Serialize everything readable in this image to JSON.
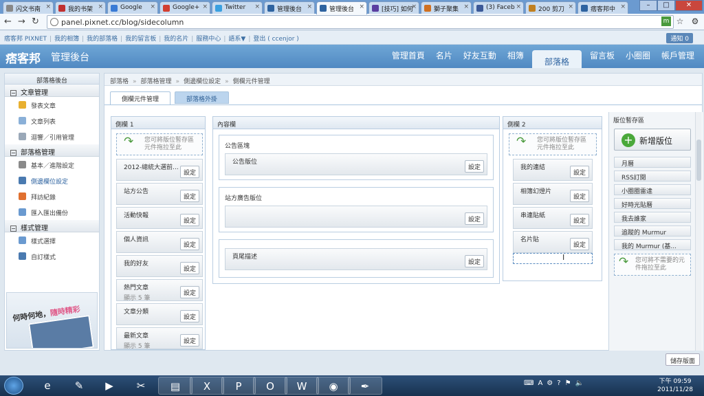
{
  "browser": {
    "tabs": [
      {
        "label": "闪文书南",
        "color": "#888888"
      },
      {
        "label": "我的书架",
        "color": "#c03030"
      },
      {
        "label": "Google",
        "color": "#3a7bd5"
      },
      {
        "label": "Google+",
        "color": "#d23f31"
      },
      {
        "label": "Twitter",
        "color": "#3aa0e0"
      },
      {
        "label": "管理後台",
        "color": "#2e63a0"
      },
      {
        "label": "管理後台",
        "color": "#2e63a0"
      },
      {
        "label": "[技巧] 如何",
        "color": "#5a3ea0"
      },
      {
        "label": "獅子聚集",
        "color": "#d07020"
      },
      {
        "label": "(3) Faceb",
        "color": "#3b5998"
      },
      {
        "label": "200 剪刀",
        "color": "#c08020"
      },
      {
        "label": "痞客邦中",
        "color": "#2e63a0"
      }
    ],
    "url": "panel.pixnet.cc/blog/sidecolumn"
  },
  "toplinks": {
    "items": [
      "痞客邦 PIXNET",
      "我的相簿",
      "我的部落格",
      "我的留言板",
      "我的名片",
      "服務中心",
      "語系▼",
      "登出 ( ccenjor )"
    ],
    "notification": "通知 0"
  },
  "header": {
    "logo": "痞客邦",
    "subtitle": "管理後台",
    "nav": [
      "管理首頁",
      "名片",
      "好友互動",
      "相簿",
      "部落格",
      "留言板",
      "小圈圈",
      "帳戶管理"
    ]
  },
  "sidebar": {
    "title": "部落格後台",
    "sec1": "文章管理",
    "items1": [
      {
        "label": "發表文章",
        "color": "#e8b030"
      },
      {
        "label": "文章列表",
        "color": "#8ab0d8"
      },
      {
        "label": "迴響／引用管理",
        "color": "#9aa8b8"
      }
    ],
    "sec2": "部落格管理",
    "items2": [
      {
        "label": "基本／進階設定",
        "color": "#8a8a8a"
      },
      {
        "label": "側邊欄位設定",
        "color": "#4a7ab0"
      },
      {
        "label": "拜訪紀錄",
        "color": "#e07030"
      },
      {
        "label": "匯入匯出備份",
        "color": "#6a9ad0"
      }
    ],
    "sec3": "樣式管理",
    "items3": [
      {
        "label": "樣式選擇",
        "color": "#6a9ad0"
      },
      {
        "label": "自訂樣式",
        "color": "#4a7ab0"
      }
    ],
    "ad_text1": "何時何地，",
    "ad_text2": "隨時精彩"
  },
  "breadcrumb": [
    "部落格",
    "部落格管理",
    "側邊欄位設定",
    "側欄元件管理"
  ],
  "subtabs": [
    "側欄元件管理",
    "部落格外掛"
  ],
  "colA": {
    "title": "側欄 1",
    "drop": "您可將版位暫存區\n元件拖拉至此",
    "widgets": [
      {
        "label": "2012-總統大選前...",
        "sub": ""
      },
      {
        "label": "站方公告",
        "sub": ""
      },
      {
        "label": "活動快報",
        "sub": ""
      },
      {
        "label": "個人資訊",
        "sub": ""
      },
      {
        "label": "我的好友",
        "sub": ""
      },
      {
        "label": "熱門文章",
        "sub": "顯示 5 筆"
      },
      {
        "label": "文章分類",
        "sub": ""
      },
      {
        "label": "最新文章",
        "sub": "顯示 5 筆"
      }
    ]
  },
  "colB": {
    "title": "內容欄",
    "box1_title": "公告區塊",
    "box1_widget": "公告版位",
    "box2_title": "站方廣告版位",
    "box3_widget": "頁尾描述"
  },
  "colC": {
    "title": "側欄 2",
    "drop": "您可將版位暫存區\n元件拖拉至此",
    "widgets": [
      "我的連結",
      "相簿幻燈片",
      "串連貼紙",
      "名片貼"
    ]
  },
  "temp": {
    "title": "版位暫存區",
    "add": "新增版位",
    "items": [
      "月曆",
      "RSS訂閱",
      "小圈圈雷達",
      "好時光貼曆",
      "我去誰家",
      "追蹤的 Murmur",
      "我的 Murmur (基..."
    ],
    "drop": "您可將不需要的元\n件拖拉至此"
  },
  "labels": {
    "config": "設定",
    "save": "儲存版面"
  },
  "taskbar": {
    "time": "下午 09:59",
    "date": "2011/11/28",
    "lang": "A"
  }
}
